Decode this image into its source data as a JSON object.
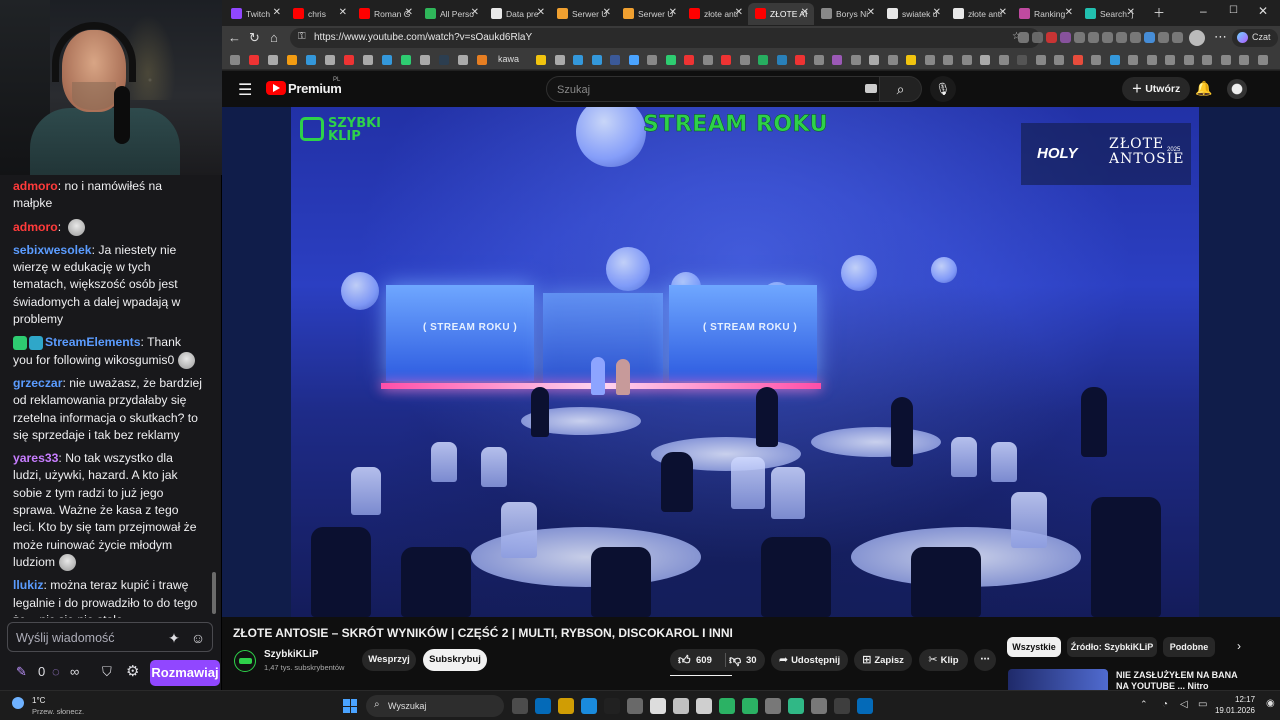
{
  "stream": {
    "chat_messages": [
      {
        "user": "admoro",
        "user_color": "#ff3b3b",
        "text": "no i namówiłeś na małpke"
      },
      {
        "user": "admoro",
        "user_color": "#ff3b3b",
        "text": "",
        "emote": "face-emote"
      },
      {
        "user": "sebixwesolek",
        "user_color": "#5b9cff",
        "text": "Ja niestety nie wierzę w edukację w tych tematach, większość osób jest świadomych a dalej wpadają w problemy"
      },
      {
        "user": "StreamElements",
        "user_color": "#5b9cff",
        "text": "Thank you for following wikosgumis0",
        "badges": [
          "mod-badge",
          "bot-badge"
        ],
        "emote": "skull-emote"
      },
      {
        "user": "grzeczar",
        "user_color": "#5b9cff",
        "text": "nie uważasz, że bardziej od reklamowania przydałaby się rzetelna informacja o skutkach? to się sprzedaje i tak bez reklamy"
      },
      {
        "user": "yares33",
        "user_color": "#c77dff",
        "text": "No tak wszystko dla ludzi, używki, hazard. A kto jak sobie z tym radzi to już jego sprawa. Ważne że kasa z tego leci. Kto by się tam przejmował że może ruinować życie młodym ludziom",
        "emote": "face-emote"
      },
      {
        "user": "llukiz",
        "user_color": "#5b9cff",
        "text": "można teraz kupić i trawę legalnie i do prowadziło to do tego że... nic się nie stało"
      }
    ],
    "chat_placeholder": "Wyślij wiadomość",
    "points": "0",
    "infinity": "∞",
    "chat_button": "Rozmawiaj",
    "accent": "#9147ff"
  },
  "browser": {
    "tabs": [
      {
        "label": "Twitch",
        "color": "#9147ff"
      },
      {
        "label": "chris",
        "color": "#ff0000"
      },
      {
        "label": "Roman G",
        "color": "#ff0000"
      },
      {
        "label": "All Perso",
        "color": "#2fb65a"
      },
      {
        "label": "Data pre",
        "color": "#e8e8e8"
      },
      {
        "label": "Serwer U",
        "color": "#f0a030"
      },
      {
        "label": "Serwer U",
        "color": "#f0a030"
      },
      {
        "label": "złote anti",
        "color": "#ff0000"
      },
      {
        "label": "ZŁOTE AI",
        "color": "#ff0000",
        "active": true
      },
      {
        "label": "Borys Ni",
        "color": "#888888"
      },
      {
        "label": "swiatek u",
        "color": "#e8e8e8"
      },
      {
        "label": "złote anti",
        "color": "#e8e8e8"
      },
      {
        "label": "Ranking",
        "color": "#c04aa0"
      },
      {
        "label": "Search: j",
        "color": "#22c0b0"
      }
    ],
    "url": "https://www.youtube.com/watch?v=sOaukd6RlaY",
    "bookmark_label": "kawa",
    "profile_label": "Czat"
  },
  "youtube": {
    "brand": "Premium",
    "country": "PL",
    "search_placeholder": "Szukaj",
    "create_label": "Utwórz",
    "video": {
      "overlay_title": "STREAM ROKU",
      "overlay_logo_line1": "SZYBKI",
      "overlay_logo_line2": "KLIP",
      "award_brand": "HOLY",
      "award_line1": "ZŁOTE",
      "award_line2": "ANTOSIE",
      "award_year": "2025",
      "screen_text": "( STREAM ROKU )"
    },
    "title": "ZŁOTE ANTOSIE – SKRÓT WYNIKÓW | CZĘŚĆ 2 | MULTI, RYBSON, DISCOKAROL I INNI",
    "channel": {
      "name": "SzybkiKLiP",
      "subs": "1,47 tys. subskrybentów"
    },
    "support_label": "Wesprzyj",
    "subscribe_label": "Subskrybuj",
    "likes": "609",
    "dislikes": "30",
    "share_label": "Udostępnij",
    "save_label": "Zapisz",
    "clip_label": "Klip",
    "chips": [
      "Wszystkie",
      "Źródło: SzybkiKLiP",
      "Podobne"
    ],
    "rec_title": "NIE ZASŁUŻYŁEM NA BANA NA YOUTUBE ... Nitro"
  },
  "taskbar": {
    "temperature": "1°C",
    "weather": "Przew. słonecz.",
    "search_label": "Wyszukaj",
    "time": "12:17",
    "date": "19.01.2026"
  }
}
